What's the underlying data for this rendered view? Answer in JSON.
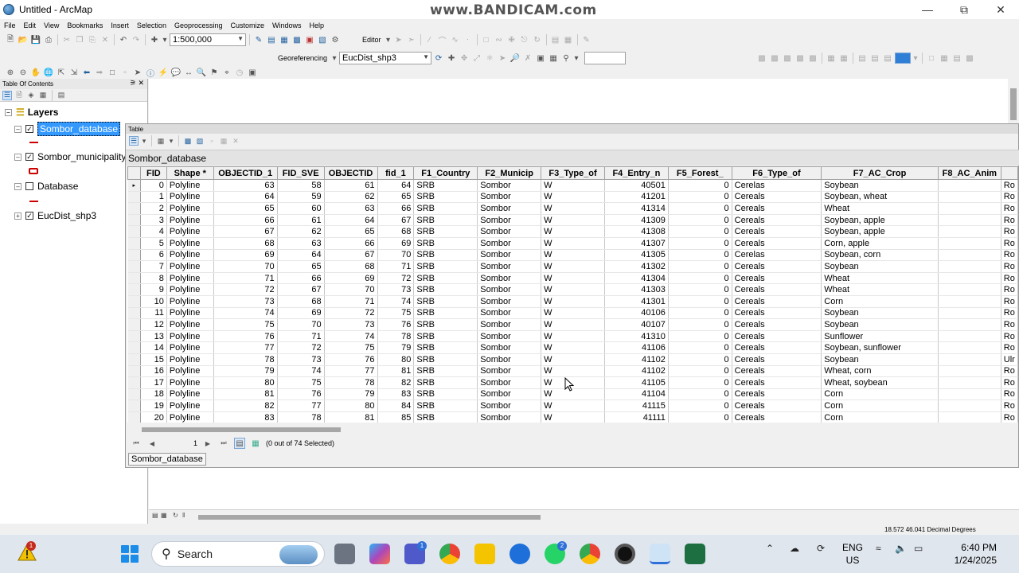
{
  "window": {
    "title": "Untitled - ArcMap",
    "watermark": "www.BANDICAM.com"
  },
  "menu": [
    "File",
    "Edit",
    "View",
    "Bookmarks",
    "Insert",
    "Selection",
    "Geoprocessing",
    "Customize",
    "Windows",
    "Help"
  ],
  "toolbar": {
    "scale_value": "1:500,000",
    "editor_label": "Editor",
    "georeferencing_label": "Georeferencing",
    "layer_combo_value": "EucDist_shp3"
  },
  "toc": {
    "title": "Table Of Contents",
    "root": "Layers",
    "layers": [
      {
        "name": "Sombor_database",
        "checked": true,
        "selected": true
      },
      {
        "name": "Sombor_municipality_",
        "checked": true,
        "selected": false
      },
      {
        "name": "Database",
        "checked": false,
        "selected": false
      },
      {
        "name": "EucDist_shp3",
        "checked": true,
        "selected": false
      }
    ]
  },
  "table": {
    "window_title": "Table",
    "tab_name": "Sombor_database",
    "bottom_tab": "Sombor_database",
    "current_record": "1",
    "selection_status": "(0 out of 74 Selected)",
    "columns": [
      "FID",
      "Shape *",
      "OBJECTID_1",
      "FID_SVE",
      "OBJECTID",
      "fid_1",
      "F1_Country",
      "F2_Municip",
      "F3_Type_of",
      "F4_Entry_n",
      "F5_Forest_",
      "F6_Type_of",
      "F7_AC_Crop",
      "F8_AC_Anim",
      ""
    ],
    "rows": [
      [
        "0",
        "Polyline",
        "63",
        "58",
        "61",
        "64",
        "SRB",
        "Sombor",
        "W",
        "40501",
        "0",
        "Cerelas",
        "Soybean",
        "",
        "Ro"
      ],
      [
        "1",
        "Polyline",
        "64",
        "59",
        "62",
        "65",
        "SRB",
        "Sombor",
        "W",
        "41201",
        "0",
        "Cereals",
        "Soybean, wheat",
        "",
        "Ro"
      ],
      [
        "2",
        "Polyline",
        "65",
        "60",
        "63",
        "66",
        "SRB",
        "Sombor",
        "W",
        "41314",
        "0",
        "Cereals",
        "Wheat",
        "",
        "Ro"
      ],
      [
        "3",
        "Polyline",
        "66",
        "61",
        "64",
        "67",
        "SRB",
        "Sombor",
        "W",
        "41309",
        "0",
        "Cereals",
        "Soybean, apple",
        "",
        "Ro"
      ],
      [
        "4",
        "Polyline",
        "67",
        "62",
        "65",
        "68",
        "SRB",
        "Sombor",
        "W",
        "41308",
        "0",
        "Cereals",
        "Soybean, apple",
        "",
        "Ro"
      ],
      [
        "5",
        "Polyline",
        "68",
        "63",
        "66",
        "69",
        "SRB",
        "Sombor",
        "W",
        "41307",
        "0",
        "Cereals",
        "Corn, apple",
        "",
        "Ro"
      ],
      [
        "6",
        "Polyline",
        "69",
        "64",
        "67",
        "70",
        "SRB",
        "Sombor",
        "W",
        "41305",
        "0",
        "Cerelas",
        "Soybean, corn",
        "",
        "Ro"
      ],
      [
        "7",
        "Polyline",
        "70",
        "65",
        "68",
        "71",
        "SRB",
        "Sombor",
        "W",
        "41302",
        "0",
        "Cereals",
        "Soybean",
        "",
        "Ro"
      ],
      [
        "8",
        "Polyline",
        "71",
        "66",
        "69",
        "72",
        "SRB",
        "Sombor",
        "W",
        "41304",
        "0",
        "Cereals",
        "Wheat",
        "",
        "Ro"
      ],
      [
        "9",
        "Polyline",
        "72",
        "67",
        "70",
        "73",
        "SRB",
        "Sombor",
        "W",
        "41303",
        "0",
        "Cereals",
        "Wheat",
        "",
        "Ro"
      ],
      [
        "10",
        "Polyline",
        "73",
        "68",
        "71",
        "74",
        "SRB",
        "Sombor",
        "W",
        "41301",
        "0",
        "Cereals",
        "Corn",
        "",
        "Ro"
      ],
      [
        "11",
        "Polyline",
        "74",
        "69",
        "72",
        "75",
        "SRB",
        "Sombor",
        "W",
        "40106",
        "0",
        "Cereals",
        "Soybean",
        "",
        "Ro"
      ],
      [
        "12",
        "Polyline",
        "75",
        "70",
        "73",
        "76",
        "SRB",
        "Sombor",
        "W",
        "40107",
        "0",
        "Cereals",
        "Soybean",
        "",
        "Ro"
      ],
      [
        "13",
        "Polyline",
        "76",
        "71",
        "74",
        "78",
        "SRB",
        "Sombor",
        "W",
        "41310",
        "0",
        "Cereals",
        "Sunflower",
        "",
        "Ro"
      ],
      [
        "14",
        "Polyline",
        "77",
        "72",
        "75",
        "79",
        "SRB",
        "Sombor",
        "W",
        "41106",
        "0",
        "Cereals",
        "Soybean, sunflower",
        "",
        "Ro"
      ],
      [
        "15",
        "Polyline",
        "78",
        "73",
        "76",
        "80",
        "SRB",
        "Sombor",
        "W",
        "41102",
        "0",
        "Cereals",
        "Soybean",
        "",
        "Ulr"
      ],
      [
        "16",
        "Polyline",
        "79",
        "74",
        "77",
        "81",
        "SRB",
        "Sombor",
        "W",
        "41102",
        "0",
        "Cereals",
        "Wheat, corn",
        "",
        "Ro"
      ],
      [
        "17",
        "Polyline",
        "80",
        "75",
        "78",
        "82",
        "SRB",
        "Sombor",
        "W",
        "41105",
        "0",
        "Cereals",
        "Wheat, soybean",
        "",
        "Ro"
      ],
      [
        "18",
        "Polyline",
        "81",
        "76",
        "79",
        "83",
        "SRB",
        "Sombor",
        "W",
        "41104",
        "0",
        "Cereals",
        "Corn",
        "",
        "Ro"
      ],
      [
        "19",
        "Polyline",
        "82",
        "77",
        "80",
        "84",
        "SRB",
        "Sombor",
        "W",
        "41115",
        "0",
        "Cereals",
        "Corn",
        "",
        "Ro"
      ],
      [
        "20",
        "Polyline",
        "83",
        "78",
        "81",
        "85",
        "SRB",
        "Sombor",
        "W",
        "41111",
        "0",
        "Cereals",
        "Corn",
        "",
        "Ro"
      ]
    ]
  },
  "statusbar": {
    "coords": "18.572  46.041 Decimal Degrees"
  },
  "taskbar": {
    "search_placeholder": "Search",
    "lang_top": "ENG",
    "lang_bottom": "US",
    "time": "6:40 PM",
    "date": "1/24/2025",
    "warning_badge": "1",
    "teams_badge": "1",
    "whatsapp_badge": "2"
  }
}
